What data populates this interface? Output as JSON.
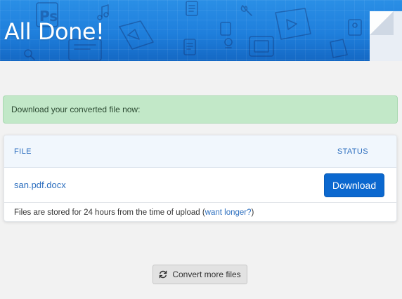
{
  "banner": {
    "title": "All Done!",
    "background_color": "#1f7fdc",
    "decoration_icons": [
      "photoshop-file-icon",
      "music-note-icon",
      "wrench-icon",
      "map-file-icon",
      "image-file-icon",
      "film-icon",
      "magnifier-icon",
      "document-icon"
    ],
    "decoration_text": "Ps"
  },
  "alert": {
    "message": "Download your converted file now:",
    "background_color": "#c2e8c8"
  },
  "files_table": {
    "columns": {
      "file": "FILE",
      "status": "STATUS"
    },
    "rows": [
      {
        "file_name": "san.pdf.docx",
        "action_label": "Download"
      }
    ],
    "footer": {
      "text": "Files are stored for 24 hours from the time of upload (",
      "link_text": "want longer?",
      "text_end": ")"
    }
  },
  "convert_more": {
    "label": "Convert more files",
    "icon": "refresh-icon"
  },
  "colors": {
    "accent": "#0b68cf",
    "link": "#2d6fbf",
    "page_background": "#f2f2f2"
  }
}
